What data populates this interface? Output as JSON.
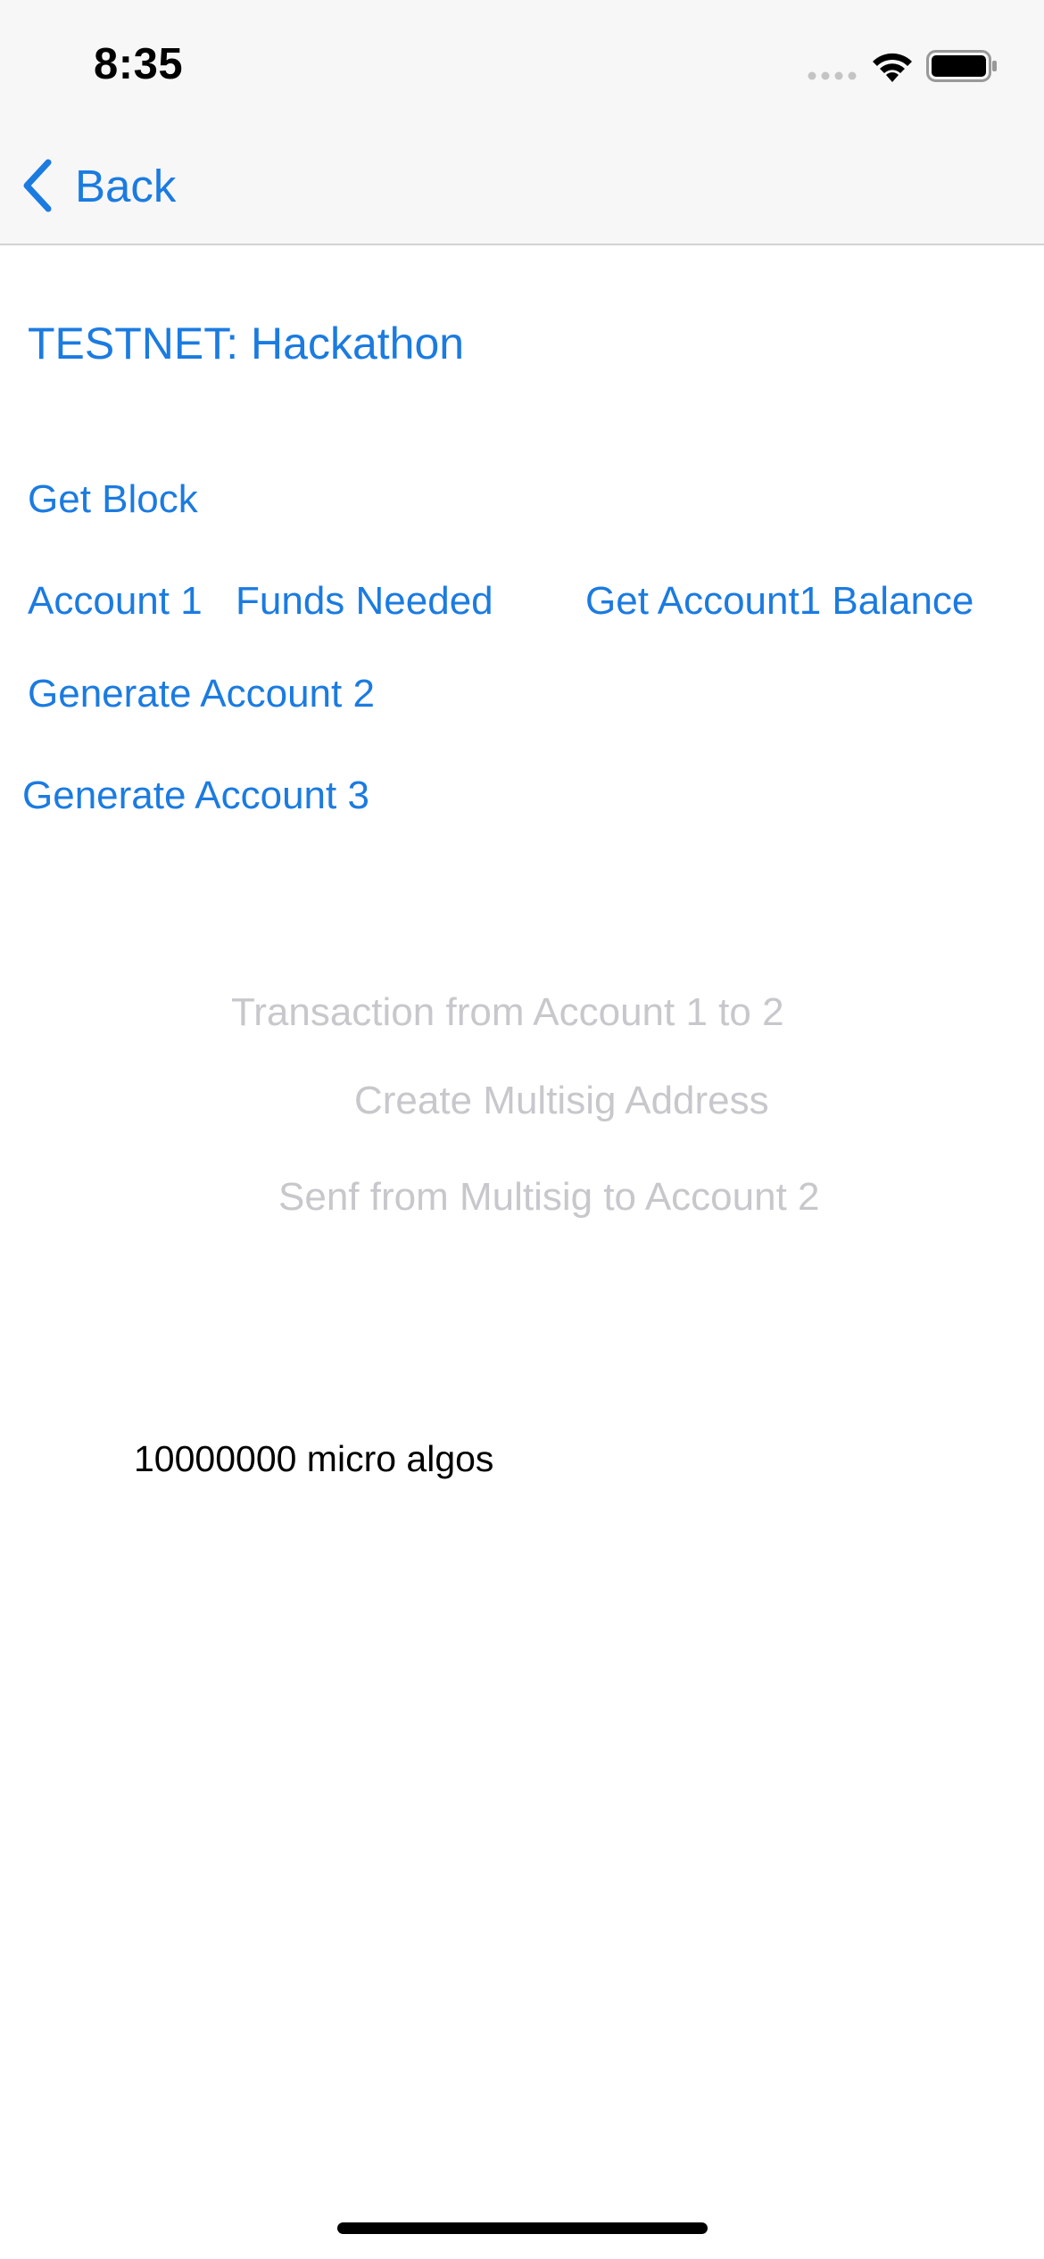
{
  "status_bar": {
    "time": "8:35"
  },
  "nav": {
    "back_label": "Back"
  },
  "content": {
    "network_title": "TESTNET: Hackathon",
    "get_block": "Get Block",
    "account1": "Account 1",
    "funds_needed": "Funds Needed",
    "get_account1_balance": "Get Account1 Balance",
    "generate_account2": "Generate Account 2",
    "generate_account3": "Generate Account 3",
    "transaction_1_to_2": "Transaction from Account 1 to 2",
    "create_multisig": "Create Multisig Address",
    "send_multisig_to_2": "Senf from Multisig to Account 2",
    "balance_value": "10000000 micro algos"
  },
  "colors": {
    "accent": "#1b7be0",
    "disabled": "#c7c7cc",
    "nav_background": "#f7f7f7"
  },
  "icons": {
    "signal": "signal-icon",
    "wifi": "wifi-icon",
    "battery": "battery-icon",
    "back": "chevron-left-icon"
  }
}
